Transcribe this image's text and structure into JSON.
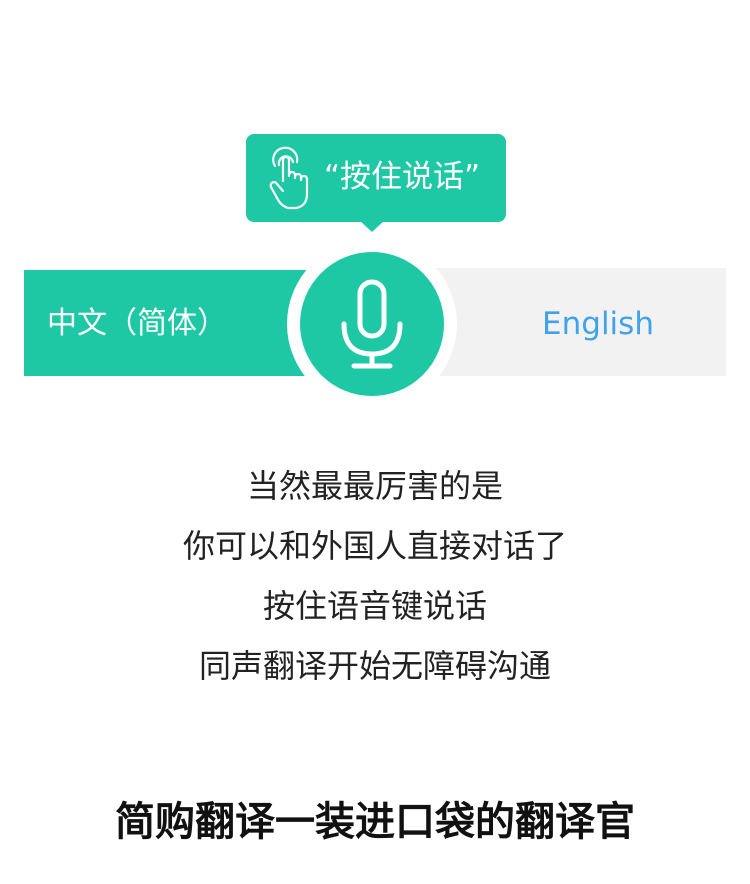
{
  "tooltip": {
    "label": "“按住说话”",
    "icon": "hand-tap-icon"
  },
  "language_bar": {
    "source_label": "中文（简体）",
    "target_label": "English",
    "mic_icon": "microphone-icon"
  },
  "description": {
    "lines": [
      "当然最最厉害的是",
      "你可以和外国人直接对话了",
      "按住语音键说话",
      "同声翻译开始无障碍沟通"
    ]
  },
  "slogan": "简购翻译一装进口袋的翻译官",
  "colors": {
    "accent": "#1ec8a5",
    "target_text": "#40a2e8",
    "inactive_bg": "#f2f2f2"
  }
}
